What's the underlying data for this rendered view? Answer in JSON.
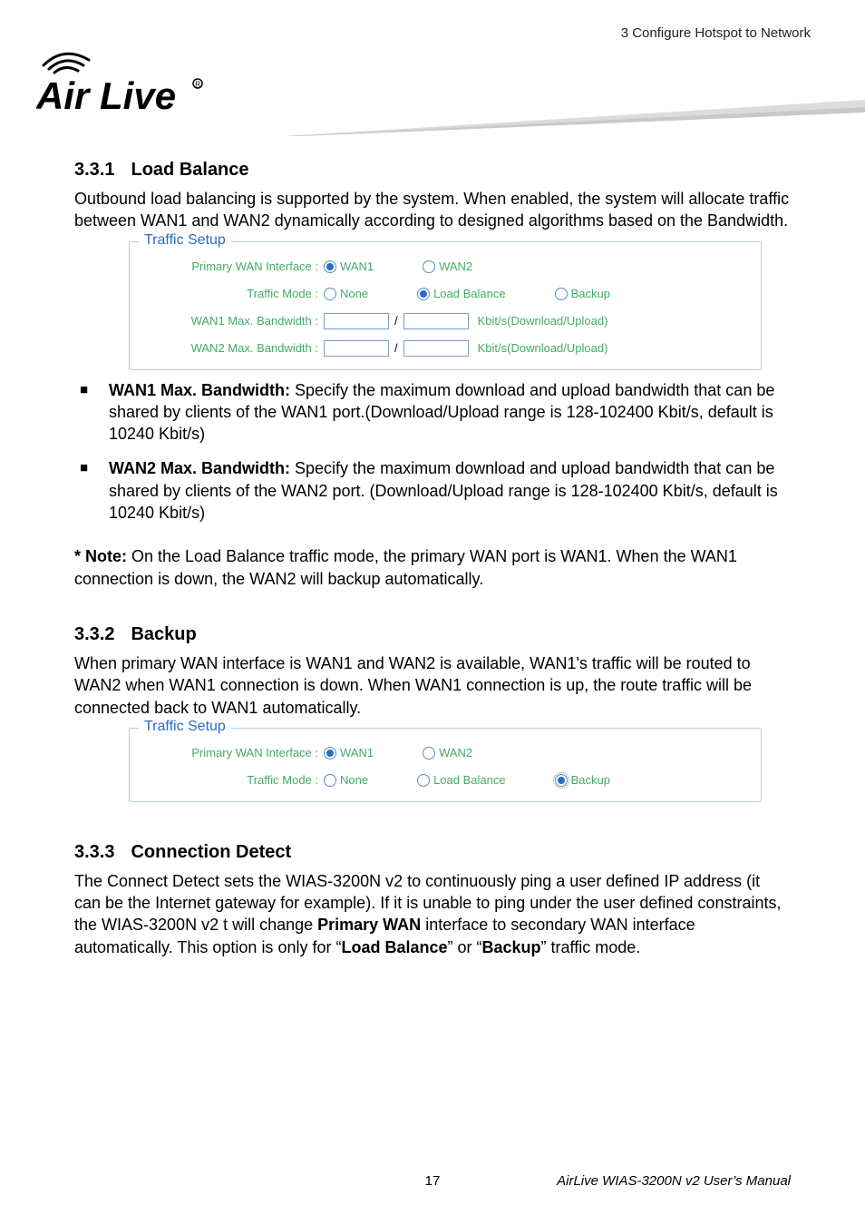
{
  "header_right": "3  Configure  Hotspot  to  Network",
  "sections": {
    "s1": {
      "num": "3.3.1",
      "title": "Load Balance",
      "intro": "Outbound load balancing is supported by the system. When enabled, the system will allocate traffic between WAN1 and WAN2 dynamically according to designed algorithms based on the Bandwidth.",
      "bullets": [
        {
          "lead": "WAN1 Max. Bandwidth:",
          "text": " Specify the maximum download and upload bandwidth that can be shared by clients of the WAN1 port.(Download/Upload range is 128-102400 Kbit/s, default is   10240 Kbit/s)"
        },
        {
          "lead": "WAN2 Max. Bandwidth:",
          "text": " Specify the maximum download and upload bandwidth that can be shared by clients of the WAN2 port. (Download/Upload range is 128-102400 Kbit/s, default is   10240 Kbit/s)"
        }
      ],
      "note_lead": "* Note:",
      "note_text": " On the Load Balance traffic mode, the primary WAN port is WAN1. When the WAN1 connection is down, the WAN2 will backup automatically."
    },
    "s2": {
      "num": "3.3.2",
      "title": "Backup",
      "intro": "When primary WAN interface is WAN1 and WAN2 is available, WAN1's traffic will be routed to WAN2 when WAN1 connection is down. When WAN1 connection is up, the route traffic will be connected back to WAN1 automatically."
    },
    "s3": {
      "num": "3.3.3",
      "title": "Connection Detect",
      "intro_part1": "The Connect Detect sets the WIAS-3200N v2 to continuously ping a user defined IP address (it can be the Internet gateway for example). If it is unable to ping under the user defined constraints, the WIAS-3200N v2 t will change ",
      "intro_bold1": "Primary WAN",
      "intro_part2": " interface to secondary WAN interface automatically. This option is only for “",
      "intro_bold2": "Load Balance",
      "intro_part3": "” or “",
      "intro_bold3": "Backup",
      "intro_part4": "” traffic mode."
    }
  },
  "traffic_setup": {
    "legend": "Traffic Setup",
    "row1_label": "Primary WAN Interface :",
    "row1_opt1": "WAN1",
    "row1_opt2": "WAN2",
    "row2_label": "Traffic Mode :",
    "row2_opt1": "None",
    "row2_opt2": "Load Balance",
    "row2_opt3": "Backup",
    "row3_label": "WAN1 Max. Bandwidth :",
    "row3_unit": "Kbit/s(Download/Upload)",
    "row4_label": "WAN2 Max. Bandwidth :",
    "row4_unit": "Kbit/s(Download/Upload)"
  },
  "footer": {
    "page_num": "17",
    "right": "AirLive WIAS-3200N v2 User’s Manual"
  }
}
